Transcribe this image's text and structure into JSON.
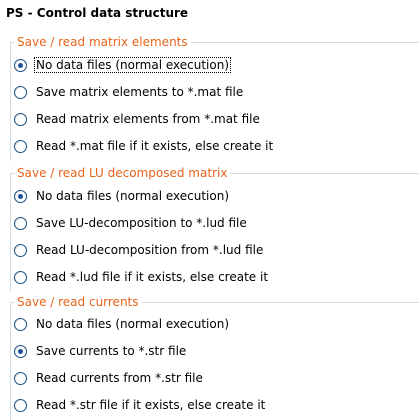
{
  "panel": {
    "title": "PS - Control data structure"
  },
  "groups": [
    {
      "legend": "Save / read matrix elements",
      "options": [
        {
          "label": "No data files (normal execution)",
          "checked": true
        },
        {
          "label": "Save matrix elements to *.mat file",
          "checked": false
        },
        {
          "label": "Read matrix elements from *.mat file",
          "checked": false
        },
        {
          "label": "Read *.mat file if it exists, else create it",
          "checked": false
        }
      ]
    },
    {
      "legend": "Save / read LU decomposed matrix",
      "options": [
        {
          "label": "No data files (normal execution)",
          "checked": true
        },
        {
          "label": "Save LU-decomposition to *.lud file",
          "checked": false
        },
        {
          "label": "Read LU-decomposition from *.lud file",
          "checked": false
        },
        {
          "label": "Read *.lud file if it exists, else create it",
          "checked": false
        }
      ]
    },
    {
      "legend": "Save / read currents",
      "options": [
        {
          "label": "No data files (normal execution)",
          "checked": false
        },
        {
          "label": "Save currents to *.str file",
          "checked": true
        },
        {
          "label": "Read currents from *.str file",
          "checked": false
        },
        {
          "label": "Read *.str file if it exists, else create it",
          "checked": false
        }
      ]
    }
  ],
  "colors": {
    "legend_text": "#e8641b",
    "group_border": "#d5dbe3",
    "radio_border": "#1c5180",
    "radio_dot": "#1f4f9a"
  }
}
